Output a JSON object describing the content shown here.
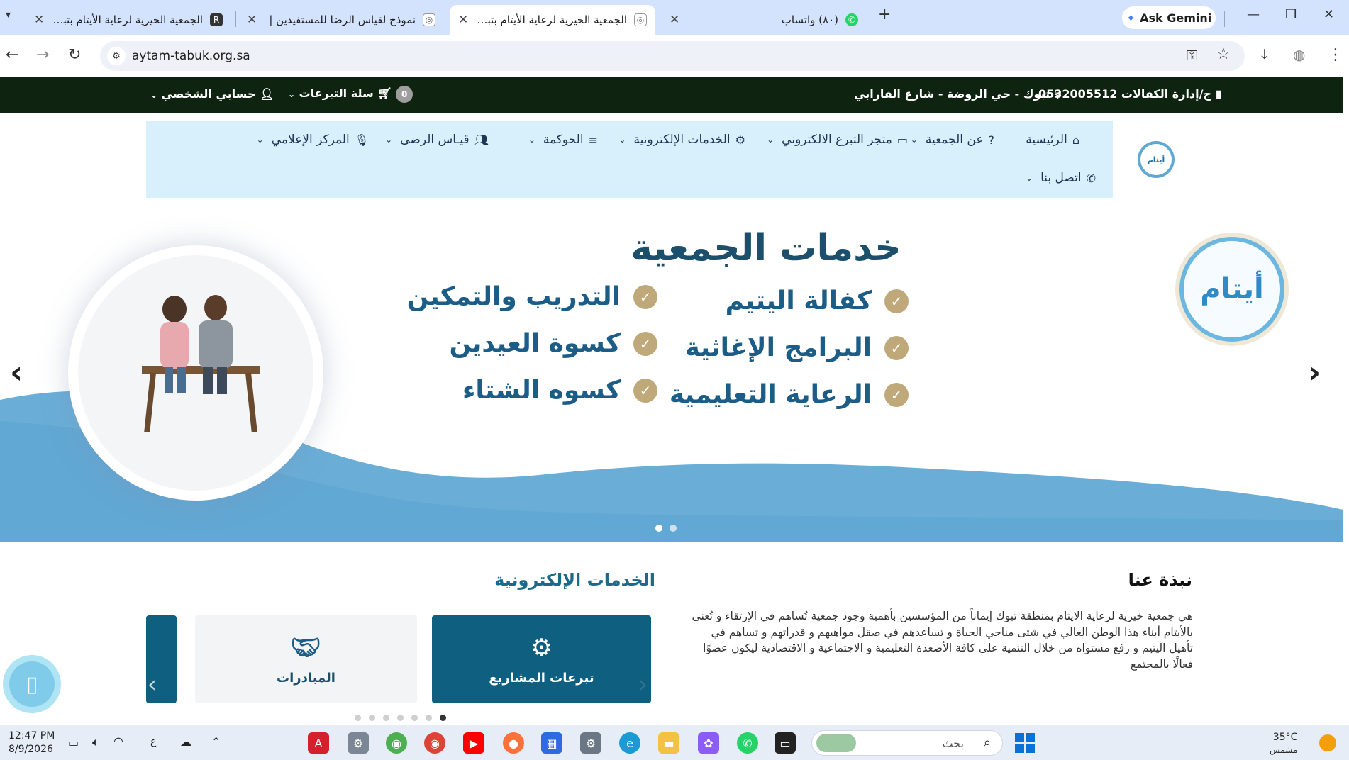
{
  "browser": {
    "tabs": [
      {
        "title": "الجمعية الخيرية لرعاية الأيتام بتبوك",
        "active": false
      },
      {
        "title": "نموذج لقياس الرضا للمستفيدين |",
        "active": false
      },
      {
        "title": "الجمعية الخيرية لرعاية الأيتام بتبوك",
        "active": true
      },
      {
        "title": "(٨٠) واتساب",
        "active": false
      }
    ],
    "gemini_label": "Ask Gemini",
    "url": "aytam-tabuk.org.sa"
  },
  "topbar": {
    "phone": "ج/إدارة الكفالات 0532005512",
    "address": "تبوك - حي الروضة - شارع الفارابي",
    "cart_label": "سلة التبرعات",
    "cart_count": "0",
    "account_label": "حسابي الشخصي"
  },
  "nav": {
    "items": [
      {
        "label": "الرئيسية",
        "icon": "home-icon"
      },
      {
        "label": "عن الجمعية",
        "icon": "question-icon"
      },
      {
        "label": "متجر التبرع الالكتروني",
        "icon": "card-icon"
      },
      {
        "label": "الخدمات الإلكترونية",
        "icon": "gears-icon"
      },
      {
        "label": "الحوكمة",
        "icon": "list-icon"
      },
      {
        "label": "قيـاس الرضى",
        "icon": "users-icon"
      },
      {
        "label": "المركز الإعلامي",
        "icon": "mic-icon"
      },
      {
        "label": "اتصل بنا",
        "icon": "phone-icon"
      }
    ]
  },
  "hero": {
    "title": "خدمات الجمعية",
    "services": [
      "كفالة اليتيم",
      "التدريب والتمكين",
      "البرامج الإغاثية",
      "كسوة العيدين",
      "الرعاية التعليمية",
      "كسوه الشتاء"
    ],
    "logo_text": "أيتام"
  },
  "about": {
    "title": "نبذة عنا",
    "text": "هي جمعية خيرية لرعاية الايتام بمنطقة تبوك إيماناً من المؤسسين بأهمية وجود جمعية تُساهم في الإرتقاء و تُعنى بالأيتام أبناء هذا الوطن الغالي في شتى مناحي الحياة و تساعدهم في صقل مواهبهم و قدراتهم و تساهم في تأهيل اليتيم و رفع مستواه من خلال التنمية على كافة الأصعدة التعليمية و الاجتماعية و الاقتصادية ليكون عضوًا فعالًا بالمجتمع"
  },
  "eservices": {
    "title": "الخدمات الإلكترونية",
    "cards": [
      {
        "label": "تبرعات المشاريع",
        "icon": "gears-icon"
      },
      {
        "label": "المبادرات",
        "icon": "handshake-icon"
      }
    ]
  },
  "taskbar": {
    "search_placeholder": "بحث",
    "time": "12:47 PM",
    "date": "8/9/2026",
    "lang": "ع",
    "weather_temp": "35°C",
    "weather_desc": "مشمس"
  },
  "colors": {
    "topbar": "#0e2410",
    "nav_bg": "#d8f0fc",
    "accent": "#0f5f80",
    "wave": "#6aaed8",
    "check": "#bfa97a"
  }
}
